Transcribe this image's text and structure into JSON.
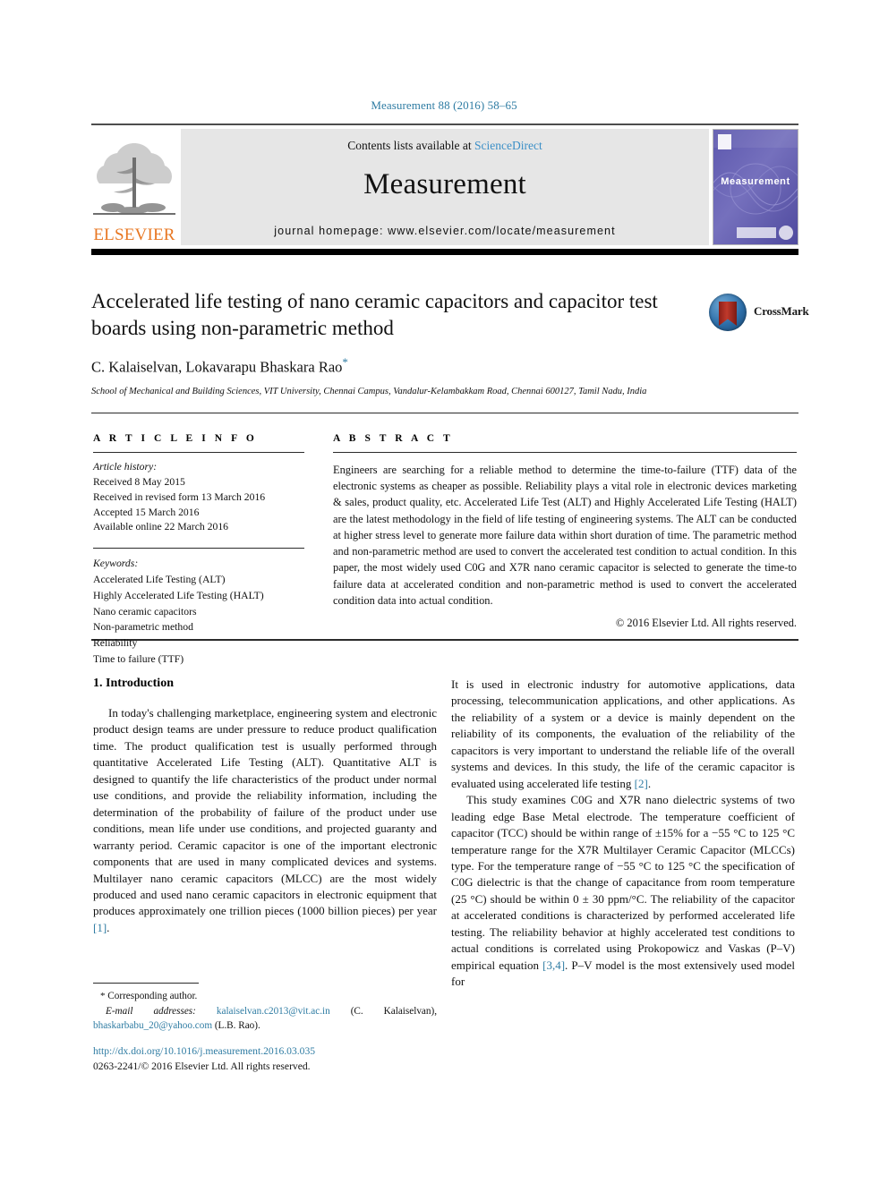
{
  "running_head": "Measurement 88 (2016) 58–65",
  "masthead": {
    "publisher_name": "ELSEVIER",
    "contents_prefix": "Contents lists available at ",
    "contents_link": "ScienceDirect",
    "journal_title": "Measurement",
    "homepage": "journal homepage: www.elsevier.com/locate/measurement",
    "cover_label": "Measurement"
  },
  "article": {
    "title": "Accelerated life testing of nano ceramic capacitors and capacitor test boards using non-parametric method",
    "authors": "C. Kalaiselvan, Lokavarapu Bhaskara Rao",
    "author_star": "*",
    "affiliation": "School of Mechanical and Building Sciences, VIT University, Chennai Campus, Vandalur-Kelambakkam Road, Chennai 600127, Tamil Nadu, India",
    "crossmark_label": "CrossMark"
  },
  "info": {
    "heading": "A R T I C L E   I N F O",
    "history_label": "Article history:",
    "history": [
      "Received 8 May 2015",
      "Received in revised form 13 March 2016",
      "Accepted 15 March 2016",
      "Available online 22 March 2016"
    ],
    "keywords_label": "Keywords:",
    "keywords": [
      "Accelerated Life Testing (ALT)",
      "Highly Accelerated Life Testing (HALT)",
      "Nano ceramic capacitors",
      "Non-parametric method",
      "Reliability",
      "Time to failure (TTF)"
    ]
  },
  "abstract": {
    "heading": "A B S T R A C T",
    "text": "Engineers are searching for a reliable method to determine the time-to-failure (TTF) data of the electronic systems as cheaper as possible. Reliability plays a vital role in electronic devices marketing & sales, product quality, etc. Accelerated Life Test (ALT) and Highly Accelerated Life Testing (HALT) are the latest methodology in the field of life testing of engineering systems. The ALT can be conducted at higher stress level to generate more failure data within short duration of time. The parametric method and non-parametric method are used to convert the accelerated test condition to actual condition. In this paper, the most widely used C0G and X7R nano ceramic capacitor is selected to generate the time-to failure data at accelerated condition and non-parametric method is used to convert the accelerated condition data into actual condition.",
    "copyright": "© 2016 Elsevier Ltd. All rights reserved."
  },
  "body": {
    "section_heading": "1. Introduction",
    "left_paragraph_1": "In today's challenging marketplace, engineering system and electronic product design teams are under pressure to reduce product qualification time. The product qualification test is usually performed through quantitative Accelerated Life Testing (ALT). Quantitative ALT is designed to quantify the life characteristics of the product under normal use conditions, and provide the reliability information, including the determination of the probability of failure of the product under use conditions, mean life under use conditions, and projected guaranty and warranty period. Ceramic capacitor is one of the important electronic components that are used in many complicated devices and systems. Multilayer nano ceramic capacitors (MLCC) are the most widely produced and used nano ceramic capacitors in electronic equipment that produces approximately one trillion pieces (1000 billion pieces) per year",
    "left_ref_1": "[1]",
    "left_tail_1": ".",
    "right_paragraph_1": "It is used in electronic industry for automotive applications, data processing, telecommunication applications, and other applications. As the reliability of a system or a device is mainly dependent on the reliability of its components, the evaluation of the reliability of the capacitors is very important to understand the reliable life of the overall systems and devices. In this study, the life of the ceramic capacitor is evaluated using accelerated life testing",
    "right_ref_1": "[2]",
    "right_tail_1": ".",
    "right_paragraph_2": "This study examines C0G and X7R nano dielectric systems of two leading edge Base Metal electrode. The temperature coefficient of capacitor (TCC) should be within range of ±15% for a −55 °C to 125 °C temperature range for the X7R Multilayer Ceramic Capacitor (MLCCs) type. For the temperature range of −55 °C to 125 °C the specification of C0G dielectric is that the change of capacitance from room temperature (25 °C) should be within 0 ± 30 ppm/°C. The reliability of the capacitor at accelerated conditions is characterized by performed accelerated life testing. The reliability behavior at highly accelerated test conditions to actual conditions is correlated using Prokopowicz and Vaskas (P–V) empirical equation",
    "right_ref_2": "[3,4]",
    "right_tail_2": ". P–V model is the most extensively used model for"
  },
  "footnote": {
    "star": "*",
    "corresponding": "Corresponding author.",
    "email_label": "E-mail addresses:",
    "email_1": "kalaiselvan.c2013@vit.ac.in",
    "email_1_owner": "(C. Kalaiselvan),",
    "email_2": "bhaskarbabu_20@yahoo.com",
    "email_2_owner": "(L.B. Rao).",
    "doi": "http://dx.doi.org/10.1016/j.measurement.2016.03.035",
    "issn": "0263-2241/© 2016 Elsevier Ltd. All rights reserved."
  },
  "colors": {
    "link": "#2f7ca3",
    "sciencedirect": "#3b8fc7",
    "elsevier_orange": "#e87722",
    "band_gray": "#e6e6e6",
    "cover_purple": "#6a66b5"
  }
}
